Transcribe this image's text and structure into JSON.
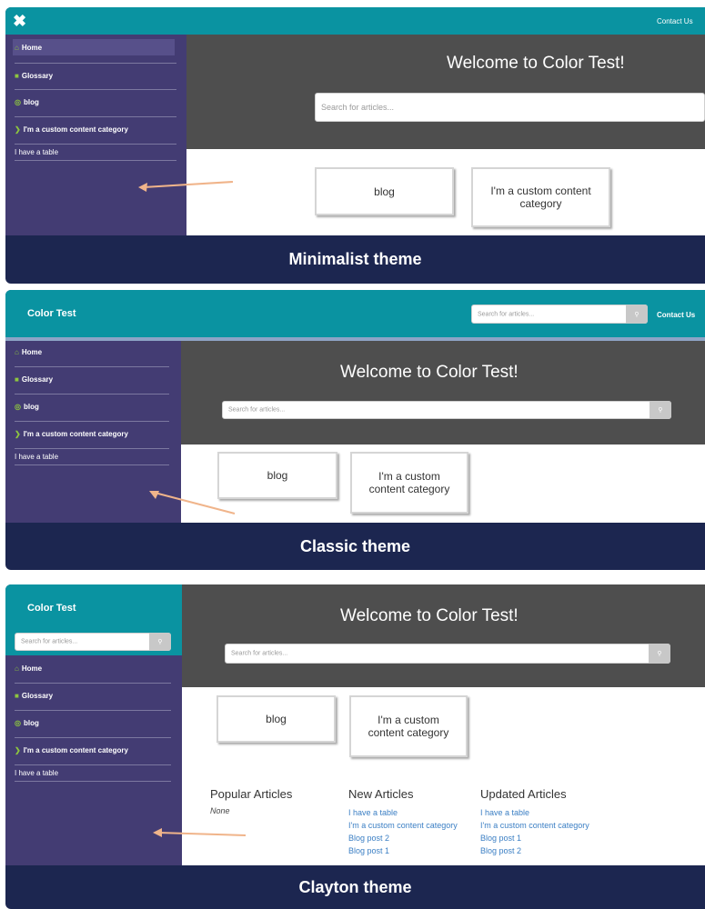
{
  "site": {
    "brand": "Color Test",
    "welcome": "Welcome to Color Test!",
    "search_placeholder": "Search for articles...",
    "contact": "Contact Us"
  },
  "nav": {
    "home": "Home",
    "glossary": "Glossary",
    "blog": "blog",
    "custom": "I'm a custom content category",
    "table": "I have a table"
  },
  "cards": {
    "blog": "blog",
    "custom": "I'm a custom content category"
  },
  "icons": {
    "close": "close-icon",
    "home": "home-icon",
    "glossary": "book-icon",
    "blog": "chat-bubble-icon",
    "custom": "chevron-right-icon",
    "search": "search-icon"
  },
  "themes": {
    "minimalist": "Minimalist theme",
    "classic": "Classic theme",
    "clayton": "Clayton theme"
  },
  "articles": {
    "popular": {
      "title": "Popular Articles",
      "empty": "None"
    },
    "new": {
      "title": "New Articles",
      "items": [
        "I have a table",
        "I'm a custom content category",
        "Blog post 2",
        "Blog post 1"
      ]
    },
    "updated": {
      "title": "Updated Articles",
      "items": [
        "I have a table",
        "I'm a custom content category",
        "Blog post 1",
        "Blog post 2"
      ]
    }
  },
  "colors": {
    "topbar": "#0a93a1",
    "sidebar": "#433c73",
    "hero": "#4e4e4e",
    "banner": "#1c2650",
    "accent_icon": "#8dc63f",
    "link": "#3b7fc4",
    "arrow": "#f0b48a"
  }
}
